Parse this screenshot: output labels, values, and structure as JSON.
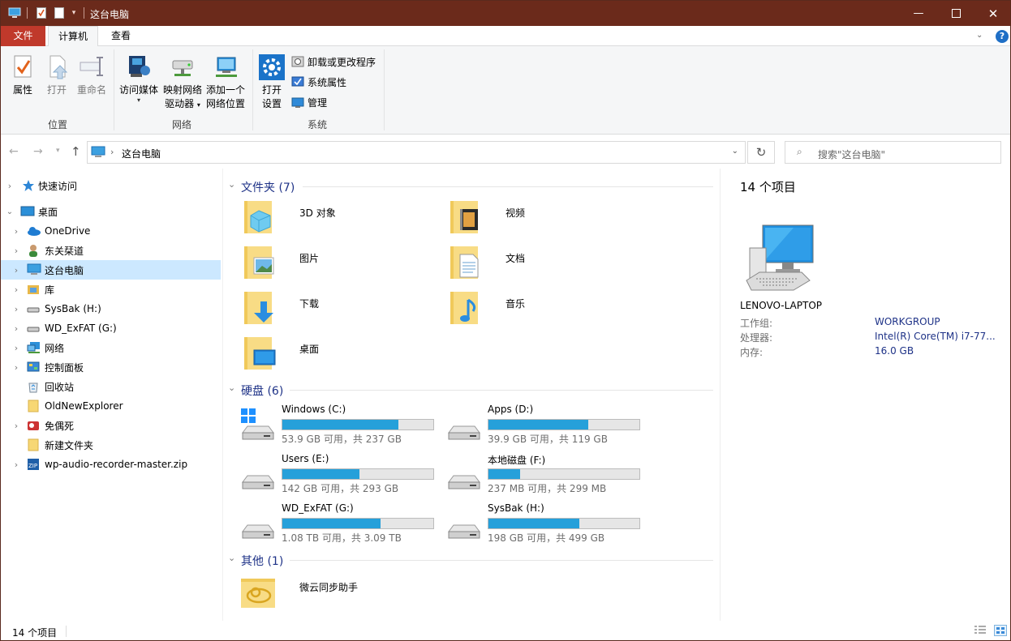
{
  "window": {
    "title": "这台电脑"
  },
  "tabs": {
    "file": "文件",
    "computer": "计算机",
    "view": "查看"
  },
  "ribbon": {
    "location": {
      "group": "位置",
      "properties": "属性",
      "open": "打开",
      "rename": "重命名"
    },
    "network": {
      "group": "网络",
      "access_media": "访问媒体",
      "map_drive_1": "映射网络",
      "map_drive_2": "驱动器",
      "add_location_1": "添加一个",
      "add_location_2": "网络位置"
    },
    "system": {
      "group": "系统",
      "open_settings_1": "打开",
      "open_settings_2": "设置",
      "uninstall": "卸载或更改程序",
      "sys_props": "系统属性",
      "manage": "管理"
    }
  },
  "address": {
    "path": "这台电脑",
    "search_placeholder": "搜索\"这台电脑\""
  },
  "nav": [
    {
      "label": "快速访问",
      "icon": "star-icon"
    },
    {
      "label": "桌面",
      "icon": "desktop-icon"
    },
    {
      "label": "OneDrive",
      "icon": "cloud-icon"
    },
    {
      "label": "东关栞道",
      "icon": "user-icon"
    },
    {
      "label": "这台电脑",
      "icon": "computer-icon"
    },
    {
      "label": "库",
      "icon": "library-icon"
    },
    {
      "label": "SysBak (H:)",
      "icon": "drive-icon"
    },
    {
      "label": "WD_ExFAT (G:)",
      "icon": "drive-icon"
    },
    {
      "label": "网络",
      "icon": "network-icon"
    },
    {
      "label": "控制面板",
      "icon": "control-panel-icon"
    },
    {
      "label": "回收站",
      "icon": "recycle-bin-icon"
    },
    {
      "label": "OldNewExplorer",
      "icon": "folder-icon"
    },
    {
      "label": "免偶死",
      "icon": "app-icon"
    },
    {
      "label": "新建文件夹",
      "icon": "folder-icon"
    },
    {
      "label": "wp-audio-recorder-master.zip",
      "icon": "zip-icon"
    }
  ],
  "sections": {
    "folders": "文件夹 (7)",
    "drives": "硬盘 (6)",
    "others": "其他 (1)"
  },
  "folders": [
    {
      "name": "3D 对象",
      "icon": "3d-objects-icon"
    },
    {
      "name": "视频",
      "icon": "videos-icon"
    },
    {
      "name": "图片",
      "icon": "pictures-icon"
    },
    {
      "name": "文档",
      "icon": "documents-icon"
    },
    {
      "name": "下载",
      "icon": "downloads-icon"
    },
    {
      "name": "音乐",
      "icon": "music-icon"
    },
    {
      "name": "桌面",
      "icon": "desktop-folder-icon"
    }
  ],
  "drives": [
    {
      "name": "Windows (C:)",
      "info": "53.9 GB 可用，共 237 GB",
      "used": 0.77,
      "icon": "windows-drive-icon"
    },
    {
      "name": "Apps (D:)",
      "info": "39.9 GB 可用，共 119 GB",
      "used": 0.66,
      "icon": "drive-icon"
    },
    {
      "name": "Users (E:)",
      "info": "142 GB 可用，共 293 GB",
      "used": 0.51,
      "icon": "drive-icon"
    },
    {
      "name": "本地磁盘 (F:)",
      "info": "237 MB 可用，共 299 MB",
      "used": 0.21,
      "icon": "drive-icon"
    },
    {
      "name": "WD_ExFAT (G:)",
      "info": "1.08 TB 可用，共 3.09 TB",
      "used": 0.65,
      "icon": "drive-icon"
    },
    {
      "name": "SysBak (H:)",
      "info": "198 GB 可用，共 499 GB",
      "used": 0.6,
      "icon": "drive-icon"
    }
  ],
  "others": [
    {
      "name": "微云同步助手",
      "icon": "weiyun-icon"
    }
  ],
  "details": {
    "count": "14 个项目",
    "pc_name": "LENOVO-LAPTOP",
    "rows": [
      {
        "k": "工作组:",
        "v": "WORKGROUP"
      },
      {
        "k": "处理器:",
        "v": "Intel(R) Core(TM) i7-77..."
      },
      {
        "k": "内存:",
        "v": "16.0 GB"
      }
    ]
  },
  "status": {
    "count": "14 个项目"
  },
  "colors": {
    "title_bg": "#6b2a1b",
    "file_tab": "#c0392b",
    "accent": "#26a0da",
    "selected": "#cce8ff",
    "section_text": "#1e3287"
  }
}
